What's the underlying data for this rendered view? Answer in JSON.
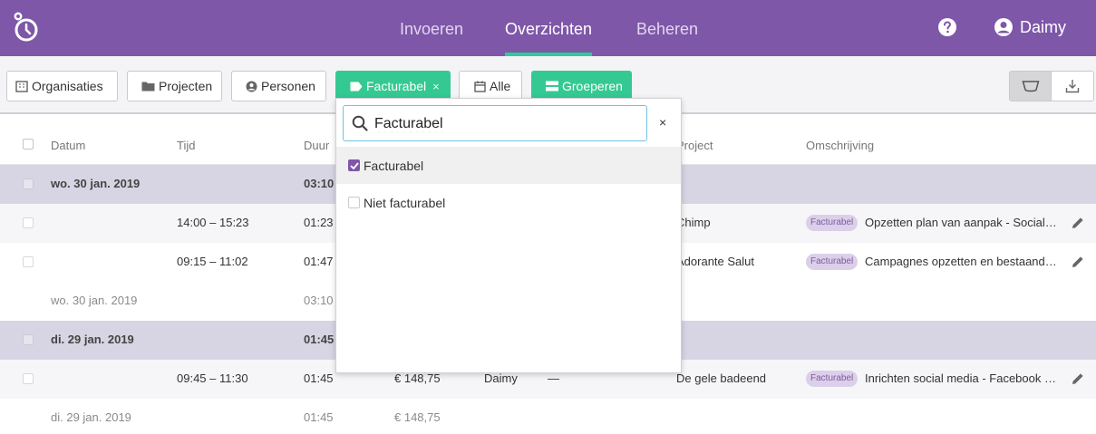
{
  "nav": {
    "items": [
      {
        "label": "Invoeren",
        "active": false
      },
      {
        "label": "Overzichten",
        "active": true
      },
      {
        "label": "Beheren",
        "active": false
      }
    ],
    "user_name": "Daimy",
    "help_icon": "question-circle-icon",
    "user_icon": "user-circle-icon"
  },
  "filters": {
    "organisaties": "Organisaties",
    "projecten": "Projecten",
    "personen": "Personen",
    "facturabel": "Facturabel",
    "facturabel_clear": "×",
    "alle": "Alle",
    "groeperen": "Groeperen"
  },
  "colors": {
    "brand": "#7e57a8",
    "accent": "#34c993"
  },
  "table": {
    "headers": {
      "datum": "Datum",
      "tijd": "Tijd",
      "duur": "Duur",
      "project": "Project",
      "omschrijving": "Omschrijving"
    },
    "groups": [
      {
        "date": "wo. 30 jan. 2019",
        "duration": "03:10",
        "rows": [
          {
            "time": "14:00 – 15:23",
            "duration": "01:23",
            "project": "Chimp",
            "badge": "Facturabel",
            "description": "Opzetten plan van aanpak - Social media"
          },
          {
            "time": "09:15 – 11:02",
            "duration": "01:47",
            "project": "Adorante Salut",
            "badge": "Facturabel",
            "description": "Campagnes opzetten en bestaande optimaliseren"
          }
        ],
        "summary": {
          "date": "wo. 30 jan. 2019",
          "duration": "03:10"
        }
      },
      {
        "date": "di. 29 jan. 2019",
        "duration": "01:45",
        "rows": [
          {
            "time": "09:45 – 11:30",
            "duration": "01:45",
            "amount": "€ 148,75",
            "person": "Daimy",
            "dash": "—",
            "project": "De gele badeend",
            "badge": "Facturabel",
            "description": "Inrichten social media - Facebook pagina"
          }
        ],
        "summary": {
          "date": "di. 29 jan. 2019",
          "duration": "01:45",
          "amount": "€ 148,75"
        }
      }
    ]
  },
  "dropdown": {
    "search_value": "Facturabel",
    "close": "×",
    "options": [
      {
        "label": "Facturabel",
        "checked": true
      },
      {
        "label": "Niet facturabel",
        "checked": false
      }
    ]
  }
}
